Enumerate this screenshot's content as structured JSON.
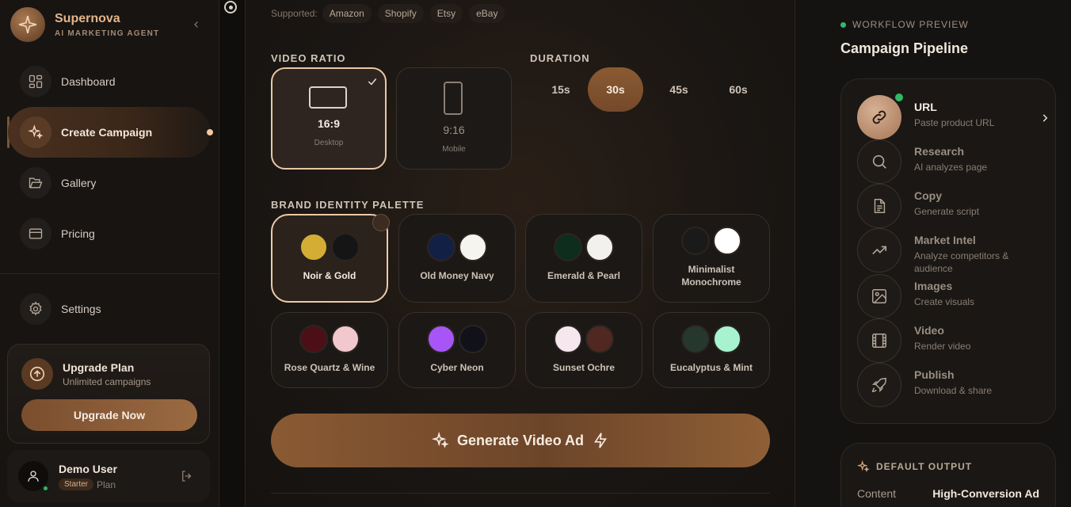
{
  "brand": {
    "name": "Supernova",
    "tagline": "AI MARKETING AGENT"
  },
  "nav": [
    {
      "label": "Dashboard",
      "icon": "grid-icon",
      "active": false
    },
    {
      "label": "Create Campaign",
      "icon": "sparkle-icon",
      "active": true
    },
    {
      "label": "Gallery",
      "icon": "folder-icon",
      "active": false
    },
    {
      "label": "Pricing",
      "icon": "credit-card-icon",
      "active": false
    }
  ],
  "settings": {
    "label": "Settings"
  },
  "upgrade": {
    "title": "Upgrade Plan",
    "subtitle": "Unlimited campaigns",
    "button": "Upgrade Now"
  },
  "user": {
    "name": "Demo User",
    "plan_badge": "Starter",
    "plan_label": "Plan"
  },
  "supported": {
    "label": "Supported:",
    "platforms": [
      "Amazon",
      "Shopify",
      "Etsy",
      "eBay"
    ]
  },
  "video_ratio": {
    "label": "VIDEO RATIO",
    "options": [
      {
        "ratio": "16:9",
        "name": "Desktop",
        "selected": true
      },
      {
        "ratio": "9:16",
        "name": "Mobile",
        "selected": false
      }
    ]
  },
  "duration": {
    "label": "DURATION",
    "options": [
      "15s",
      "30s",
      "45s",
      "60s"
    ],
    "selected": "30s"
  },
  "palette": {
    "label": "BRAND IDENTITY PALETTE",
    "options": [
      {
        "name": "Noir & Gold",
        "colors": [
          "#d4ae34",
          "#151515"
        ],
        "selected": true
      },
      {
        "name": "Old Money Navy",
        "colors": [
          "#132046",
          "#f6f4ef"
        ],
        "selected": false
      },
      {
        "name": "Emerald & Pearl",
        "colors": [
          "#0f2d1d",
          "#f3f1ee"
        ],
        "selected": false
      },
      {
        "name": "Minimalist Monochrome",
        "colors": [
          "#1a1a1a",
          "#ffffff"
        ],
        "selected": false
      },
      {
        "name": "Rose Quartz & Wine",
        "colors": [
          "#4c0f17",
          "#f0c8ce"
        ],
        "selected": false
      },
      {
        "name": "Cyber Neon",
        "colors": [
          "#a855f7",
          "#11111a"
        ],
        "selected": false
      },
      {
        "name": "Sunset Ochre",
        "colors": [
          "#f6e6ee",
          "#502821"
        ],
        "selected": false
      },
      {
        "name": "Eucalyptus & Mint",
        "colors": [
          "#26382e",
          "#a7f3d0"
        ],
        "selected": false
      }
    ]
  },
  "generate": {
    "label": "Generate Video Ad"
  },
  "workflow": {
    "label": "WORKFLOW PREVIEW",
    "title": "Campaign Pipeline",
    "steps": [
      {
        "title": "URL",
        "subtitle": "Paste product URL",
        "icon": "link-icon",
        "active": true
      },
      {
        "title": "Research",
        "subtitle": "AI analyzes page",
        "icon": "search-icon",
        "active": false
      },
      {
        "title": "Copy",
        "subtitle": "Generate script",
        "icon": "document-icon",
        "active": false
      },
      {
        "title": "Market Intel",
        "subtitle": "Analyze competitors & audience",
        "icon": "trending-icon",
        "active": false
      },
      {
        "title": "Images",
        "subtitle": "Create visuals",
        "icon": "image-icon",
        "active": false
      },
      {
        "title": "Video",
        "subtitle": "Render video",
        "icon": "film-icon",
        "active": false
      },
      {
        "title": "Publish",
        "subtitle": "Download & share",
        "icon": "rocket-icon",
        "active": false
      }
    ]
  },
  "default_output": {
    "label": "DEFAULT OUTPUT",
    "key": "Content",
    "value": "High-Conversion Ad"
  },
  "colors": {
    "accent": "#8a5a33",
    "accent_light": "#e3b58a",
    "online": "#2fb866"
  }
}
